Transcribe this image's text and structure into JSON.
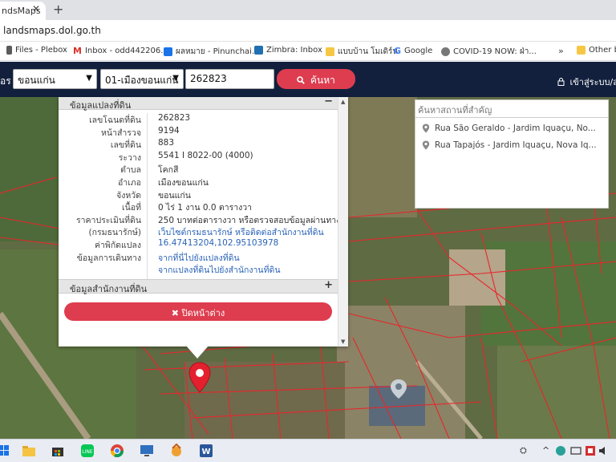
{
  "browser": {
    "tab_title": "ndsMaps",
    "url": "landsmaps.dol.go.th",
    "new_tab_symbol": "+",
    "bookmarks": [
      {
        "label": "Files - Plebox",
        "color": "#5b5b5b"
      },
      {
        "label": "Inbox - odd442206...",
        "color": "#d93025"
      },
      {
        "label": "ผลหมาย - Pinunchai...",
        "color": "#1a73e8"
      },
      {
        "label": "Zimbra: Inbox",
        "color": "#1f6fb2"
      },
      {
        "label": "แบบบ้าน โมเดิร์น",
        "color": "#f6c744"
      },
      {
        "label": "Google",
        "color": "#4285f4"
      },
      {
        "label": "COVID-19 NOW: ฝ่า...",
        "color": "#555555"
      },
      {
        "label": "Other bo",
        "color": "#f6c744"
      }
    ]
  },
  "header": {
    "label_fragment": "อร",
    "province": "ขอนแก่น",
    "district": "01-เมืองขอนแก่น",
    "parcel_number": "262823",
    "search_label": "ค้นหา",
    "login_label": "เข้าสู่ระบบ/ล"
  },
  "info_panel": {
    "title": "ข้อมูลแปลงที่ดิน",
    "collapse_symbol": "−",
    "rows": [
      {
        "key": "เลขโฉนดที่ดิน",
        "value": "262823"
      },
      {
        "key": "หน้าสำรวจ",
        "value": "9194"
      },
      {
        "key": "เลขที่ดิน",
        "value": "883"
      },
      {
        "key": "ระวาง",
        "value": "5541 I 8022-00 (4000)"
      },
      {
        "key": "ตำบล",
        "value": "โคกสี"
      },
      {
        "key": "อำเภอ",
        "value": "เมืองขอนแก่น"
      },
      {
        "key": "จังหวัด",
        "value": "ขอนแก่น"
      },
      {
        "key": "เนื้อที่",
        "value": "0 ไร่ 1 งาน 0.0 ตารางวา"
      },
      {
        "key": "ราคาประเมินที่ดิน",
        "value": "250 บาทต่อตารางวา หรือตรวจสอบข้อมูลผ่านทาง"
      },
      {
        "key": "(กรมธนารักษ์)",
        "value": "เว็บไซต์กรมธนารักษ์ หรือติดต่อสำนักงานที่ดิน"
      },
      {
        "key": "ค่าพิกัดแปลง",
        "value": "16.47413204,102.95103978"
      },
      {
        "key": "ข้อมูลการเดินทาง",
        "value": "จากที่นี่ไปยังแปลงที่ดิน"
      },
      {
        "key": "",
        "value": "จากแปลงที่ดินไปยังสำนักงานที่ดิน"
      }
    ],
    "office_title": "ข้อมูลสำนักงานที่ดิน",
    "expand_symbol": "+",
    "close_label": "✖ ปิดหน้าต่าง"
  },
  "place_search": {
    "placeholder": "ค้นหาสถานที่สำคัญ",
    "results": [
      "Rua São Geraldo - Jardim Iquaçu, No...",
      "Rua Tapajós - Jardim Iquaçu, Nova Iq..."
    ]
  },
  "colors": {
    "header_bg": "#12203d",
    "accent_red": "#de3d4f",
    "parcel_line": "#e8262c"
  }
}
